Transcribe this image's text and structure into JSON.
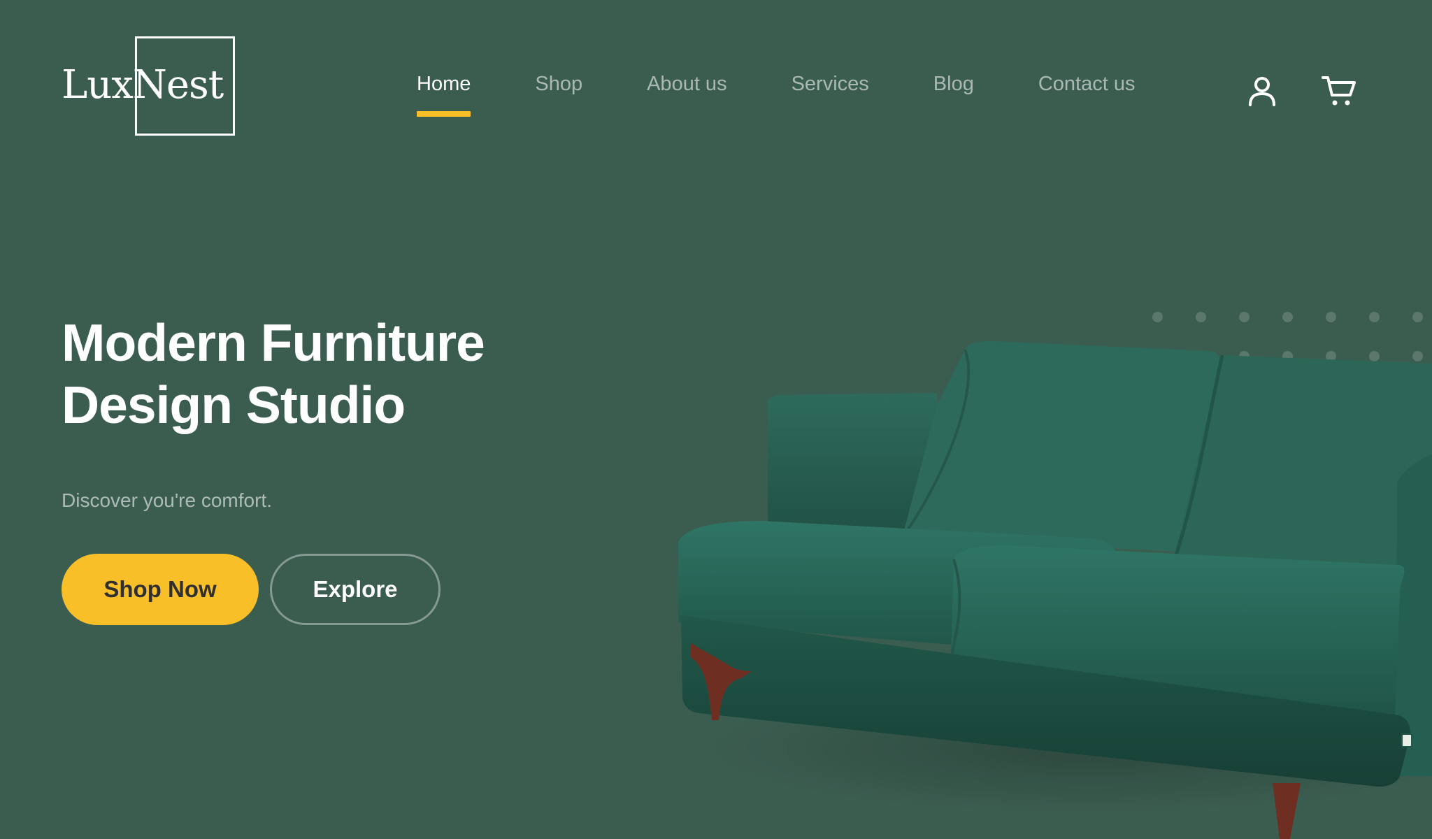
{
  "brand": {
    "name": "LuxNest"
  },
  "nav": {
    "items": [
      {
        "label": "Home",
        "active": true
      },
      {
        "label": "Shop",
        "active": false
      },
      {
        "label": "About us",
        "active": false
      },
      {
        "label": "Services",
        "active": false
      },
      {
        "label": "Blog",
        "active": false
      },
      {
        "label": "Contact us",
        "active": false
      }
    ]
  },
  "header_icons": {
    "user": "user-icon",
    "cart": "cart-icon"
  },
  "hero": {
    "title_line1": "Modern Furniture",
    "title_line2": "Design Studio",
    "subtitle": "Discover you're comfort.",
    "primary_button": "Shop Now",
    "secondary_button": "Explore",
    "image": "green-velvet-sofa"
  },
  "colors": {
    "background": "#3b5d50",
    "accent": "#f9bf29",
    "text": "#ffffff",
    "sofa": "#2e6656"
  }
}
